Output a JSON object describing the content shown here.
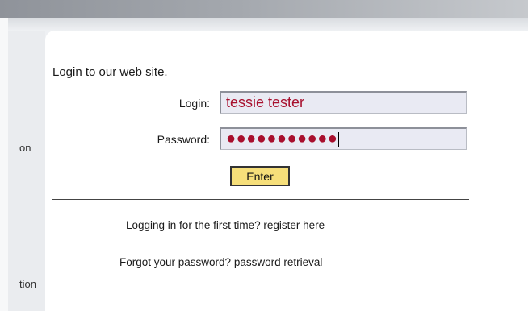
{
  "side_nav": {
    "item_1": "on",
    "item_2": "tion"
  },
  "login_form": {
    "intro": "Login to our web site.",
    "login_label": "Login:",
    "login_value": "tessie tester",
    "password_label": "Password:",
    "password_value": "●●●●●●●●●●●",
    "enter_label": "Enter"
  },
  "help": {
    "first_time_text": "Logging in for the first time?",
    "register_link": "register here",
    "forgot_text": "Forgot your password?",
    "retrieval_link": "password retrieval"
  },
  "colors": {
    "field_text": "#a80f2d",
    "button_bg": "#f6df7a"
  }
}
